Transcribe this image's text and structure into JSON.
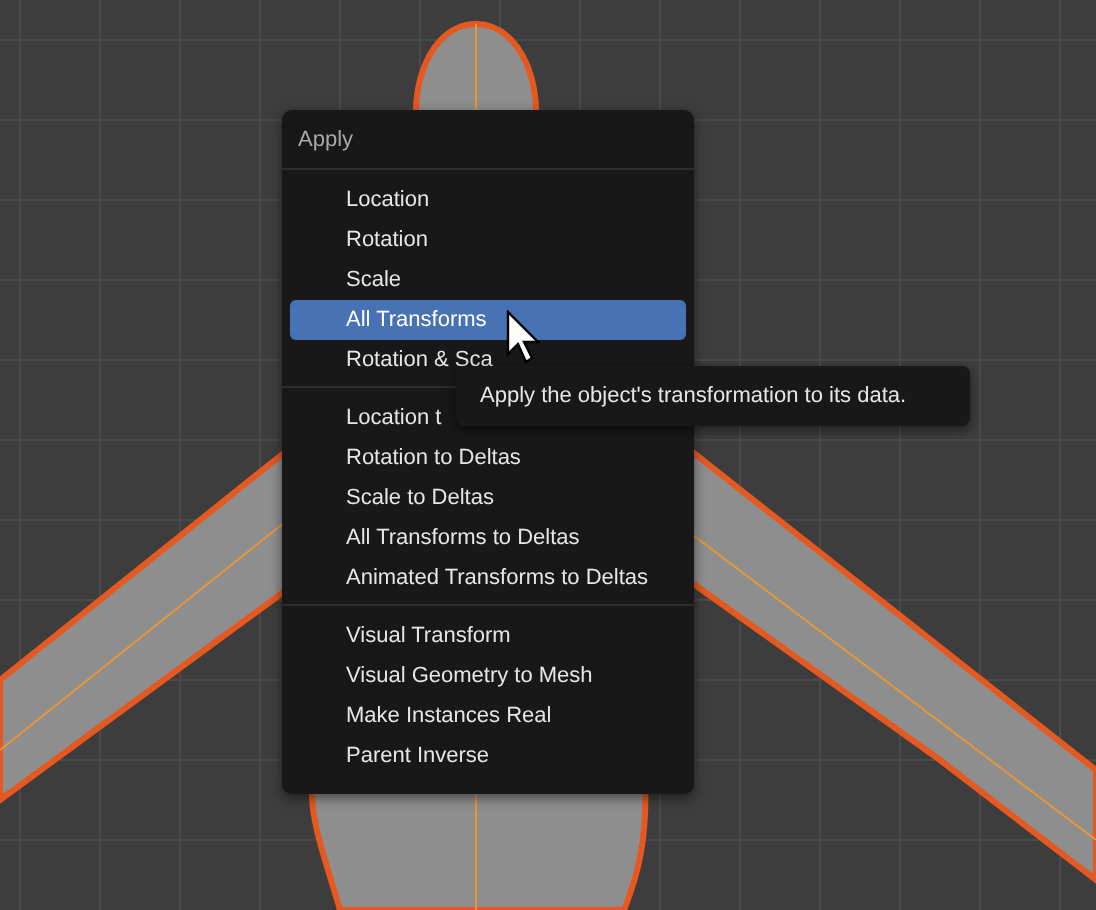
{
  "menu": {
    "title": "Apply",
    "sections": [
      {
        "items": [
          {
            "label": "Location",
            "selected": false
          },
          {
            "label": "Rotation",
            "selected": false
          },
          {
            "label": "Scale",
            "selected": false
          },
          {
            "label": "All Transforms",
            "selected": true
          },
          {
            "label": "Rotation & Sca",
            "selected": false
          }
        ]
      },
      {
        "items": [
          {
            "label": "Location t",
            "selected": false
          },
          {
            "label": "Rotation to Deltas",
            "selected": false
          },
          {
            "label": "Scale to Deltas",
            "selected": false
          },
          {
            "label": "All Transforms to Deltas",
            "selected": false
          },
          {
            "label": "Animated Transforms to Deltas",
            "selected": false
          }
        ]
      },
      {
        "items": [
          {
            "label": "Visual Transform",
            "selected": false
          },
          {
            "label": "Visual Geometry to Mesh",
            "selected": false
          },
          {
            "label": "Make Instances Real",
            "selected": false
          },
          {
            "label": "Parent Inverse",
            "selected": false
          }
        ]
      }
    ]
  },
  "tooltip": {
    "text": "Apply the object's transformation to its data."
  }
}
